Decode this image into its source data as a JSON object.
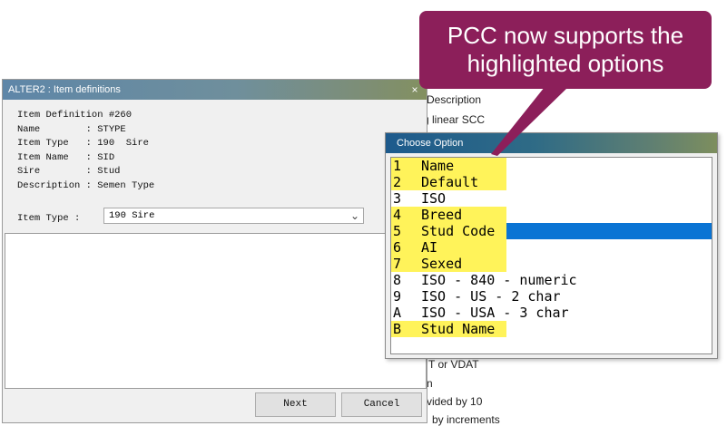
{
  "background": {
    "lines": [
      "Description",
      "g linear SCC",
      "T or VDAT",
      "n",
      "vided by 10",
      "by increments"
    ]
  },
  "dialog": {
    "title": "ALTER2 : Item definitions",
    "close_label": "×",
    "info_lines": [
      "Item Definition #260",
      "Name        : STYPE",
      "Item Type   : 190  Sire",
      "Item Name   : SID",
      "Sire        : Stud",
      "Description : Semen Type"
    ],
    "item_type_label": "Item Type :",
    "item_type_value": "190 Sire",
    "next_label": "Next",
    "cancel_label": "Cancel"
  },
  "popup": {
    "title": "Choose Option",
    "options": [
      {
        "code": "1",
        "name": "Name",
        "highlighted": true,
        "selected": false
      },
      {
        "code": "2",
        "name": "Default",
        "highlighted": true,
        "selected": false
      },
      {
        "code": "3",
        "name": "ISO",
        "highlighted": false,
        "selected": false
      },
      {
        "code": "4",
        "name": "Breed",
        "highlighted": true,
        "selected": false
      },
      {
        "code": "5",
        "name": "Stud Code",
        "highlighted": true,
        "selected": true
      },
      {
        "code": "6",
        "name": "AI",
        "highlighted": true,
        "selected": false
      },
      {
        "code": "7",
        "name": "Sexed",
        "highlighted": true,
        "selected": false
      },
      {
        "code": "8",
        "name": "ISO - 840 - numeric",
        "highlighted": false,
        "selected": false
      },
      {
        "code": "9",
        "name": "ISO - US - 2 char",
        "highlighted": false,
        "selected": false
      },
      {
        "code": "A",
        "name": "ISO - USA - 3 char",
        "highlighted": false,
        "selected": false
      },
      {
        "code": "B",
        "name": "Stud Name",
        "highlighted": true,
        "selected": false
      }
    ]
  },
  "callout": {
    "line1": "PCC now supports the",
    "line2": "highlighted options"
  },
  "colors": {
    "highlight": "#fff35a",
    "selection": "#0a74d4",
    "callout": "#8c1f5a"
  }
}
